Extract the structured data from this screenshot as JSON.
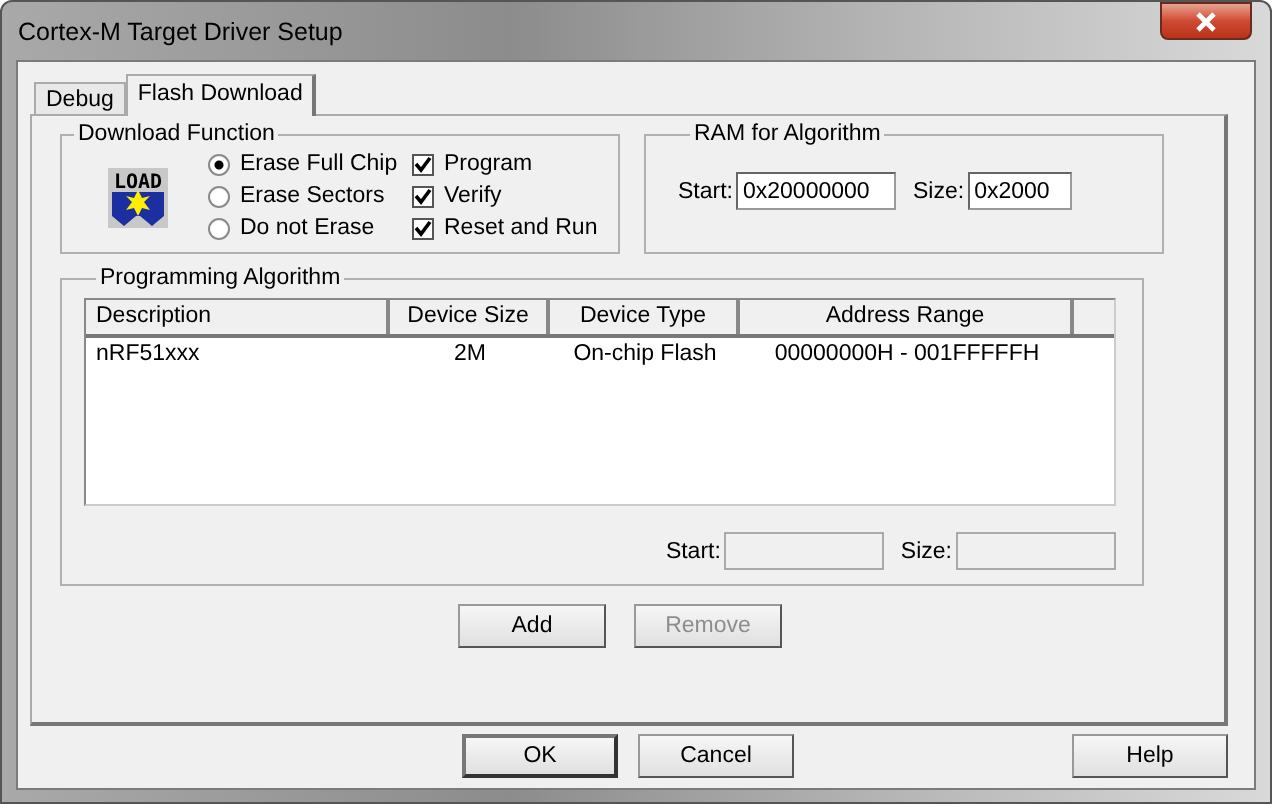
{
  "window": {
    "title": "Cortex-M Target Driver Setup"
  },
  "tabs": [
    {
      "label": "Debug",
      "selected": false
    },
    {
      "label": "Flash Download",
      "selected": true
    }
  ],
  "download_function": {
    "title": "Download Function",
    "icon_text": "LOAD",
    "erase_options": [
      {
        "label": "Erase Full Chip",
        "selected": true
      },
      {
        "label": "Erase Sectors",
        "selected": false
      },
      {
        "label": "Do not Erase",
        "selected": false
      }
    ],
    "options": [
      {
        "label": "Program",
        "checked": true
      },
      {
        "label": "Verify",
        "checked": true
      },
      {
        "label": "Reset and Run",
        "checked": true
      }
    ]
  },
  "ram_for_algorithm": {
    "title": "RAM for Algorithm",
    "start_label": "Start:",
    "start_value": "0x20000000",
    "size_label": "Size:",
    "size_value": "0x2000"
  },
  "programming_algorithm": {
    "title": "Programming Algorithm",
    "table": {
      "columns": [
        "Description",
        "Device Size",
        "Device Type",
        "Address Range"
      ],
      "rows": [
        {
          "cells": [
            "nRF51xxx",
            "2M",
            "On-chip Flash",
            "00000000H - 001FFFFFH"
          ]
        }
      ]
    },
    "start_label": "Start:",
    "size_label": "Size:"
  },
  "list_buttons": [
    {
      "label": "Add",
      "disabled": false
    },
    {
      "label": "Remove",
      "disabled": true
    }
  ],
  "buttons": [
    {
      "label": "OK",
      "default": true
    },
    {
      "label": "Cancel",
      "default": false
    },
    {
      "label": "Help",
      "default": false
    }
  ]
}
